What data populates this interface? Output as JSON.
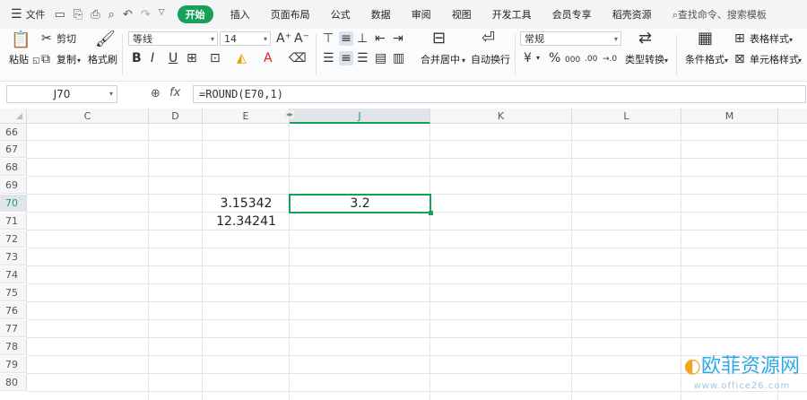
{
  "menubar": {
    "file_label": "文件",
    "tabs": [
      "开始",
      "插入",
      "页面布局",
      "公式",
      "数据",
      "审阅",
      "视图",
      "开发工具",
      "会员专享",
      "稻壳资源"
    ],
    "search_placeholder": "查找命令、搜索模板"
  },
  "ribbon": {
    "paste": "粘贴",
    "cut": "剪切",
    "copy": "复制",
    "format_painter": "格式刷",
    "font_name": "等线",
    "font_size": "14",
    "merge_center": "合并居中",
    "wrap_text": "自动换行",
    "number_format": "常规",
    "type_convert": "类型转换",
    "cond_format": "条件格式",
    "table_style": "表格样式",
    "cell_style": "单元格样式",
    "percent_symbol": "%",
    "thousands_symbol": "000",
    "inc_decimal": ".00",
    "dec_decimal": "→.0",
    "currency_symbol": "¥"
  },
  "formula_bar": {
    "name_box": "J70",
    "fx_label": "fx",
    "formula": "=ROUND(E70,1)"
  },
  "sheet": {
    "columns": [
      "C",
      "D",
      "E",
      "J",
      "K",
      "L",
      "M"
    ],
    "rows": [
      "66",
      "67",
      "68",
      "69",
      "70",
      "71",
      "72",
      "73",
      "74",
      "75",
      "76",
      "77",
      "78",
      "79",
      "80"
    ],
    "cells": {
      "E70": "3.15342",
      "E71": "12.34241",
      "J70": "3.2"
    }
  },
  "watermark": {
    "title": "欧菲资源网",
    "url": "www.office26.com"
  }
}
